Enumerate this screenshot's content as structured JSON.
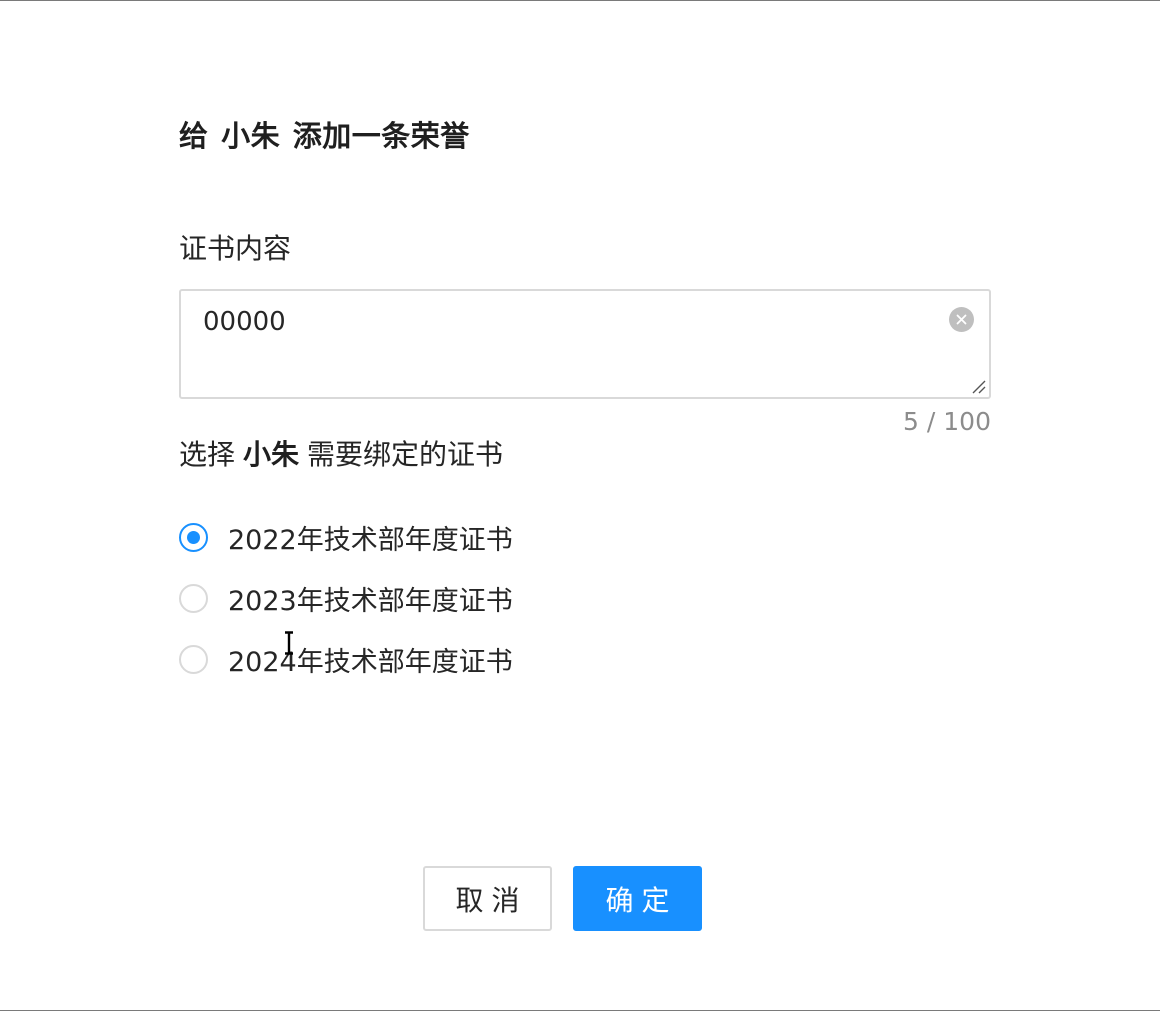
{
  "dialog": {
    "title_prefix": "给",
    "title_name": "小朱",
    "title_suffix": "添加一条荣誉"
  },
  "certificate_field": {
    "label": "证书内容",
    "value": "00000",
    "counter": "5 / 100"
  },
  "bind_section": {
    "label_prefix": "选择",
    "label_name": "小朱",
    "label_suffix": "需要绑定的证书",
    "options": [
      {
        "label": "2022年技术部年度证书",
        "checked": true
      },
      {
        "label": "2023年技术部年度证书",
        "checked": false
      },
      {
        "label": "2024年技术部年度证书",
        "checked": false
      }
    ]
  },
  "footer": {
    "cancel_label": "取消",
    "ok_label": "确定"
  },
  "colors": {
    "primary": "#1890ff",
    "border": "#d9d9d9",
    "muted_text": "#8c8c8c"
  },
  "icons": {
    "clear": "close-circle-icon",
    "resize": "resize-handle-icon",
    "cursor": "text-cursor-icon"
  }
}
